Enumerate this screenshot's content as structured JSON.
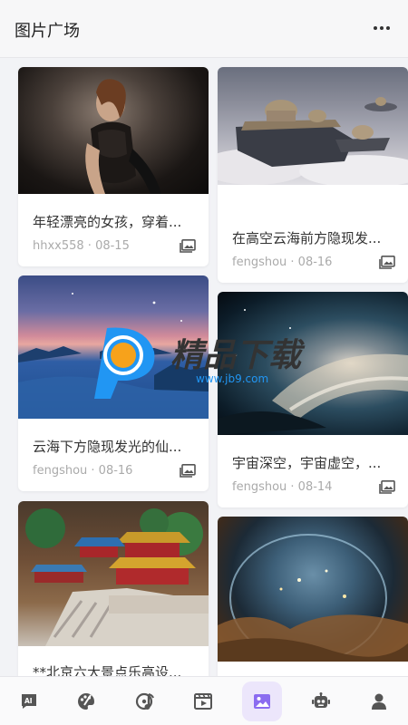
{
  "header": {
    "title": "图片广场",
    "more_icon": "more-dots-icon"
  },
  "cards": [
    {
      "title": "年轻漂亮的女孩，穿着...",
      "author": "hhxx558",
      "date": "08-15",
      "meta": "hhxx558 · 08-15"
    },
    {
      "title": "在高空云海前方隐现发...",
      "author": "fengshou",
      "date": "08-16",
      "meta": "fengshou · 08-16"
    },
    {
      "title": "云海下方隐现发光的仙...",
      "author": "fengshou",
      "date": "08-16",
      "meta": "fengshou · 08-16"
    },
    {
      "title": "宇宙深空，宇宙虚空，...",
      "author": "fengshou",
      "date": "08-14",
      "meta": "fengshou · 08-14"
    },
    {
      "title": "**北京六大景点乐高设...",
      "author": "",
      "date": "",
      "meta": ""
    },
    {
      "title": "",
      "author": "",
      "date": "",
      "meta": ""
    }
  ],
  "watermark": {
    "brand": "精品下载",
    "url": "www.jb9.com"
  },
  "tabs": [
    {
      "name": "ai-chat",
      "icon": "ai-chat-icon",
      "active": false
    },
    {
      "name": "painting",
      "icon": "palette-icon",
      "active": false
    },
    {
      "name": "music",
      "icon": "music-note-icon",
      "active": false
    },
    {
      "name": "video",
      "icon": "video-clapper-icon",
      "active": false
    },
    {
      "name": "image-gallery",
      "icon": "image-icon",
      "active": true
    },
    {
      "name": "robot",
      "icon": "robot-icon",
      "active": false
    },
    {
      "name": "profile",
      "icon": "user-icon",
      "active": false
    }
  ],
  "colors": {
    "accent": "#8b6cf0",
    "accent_bg": "#ece6fb",
    "icon": "#555555"
  }
}
